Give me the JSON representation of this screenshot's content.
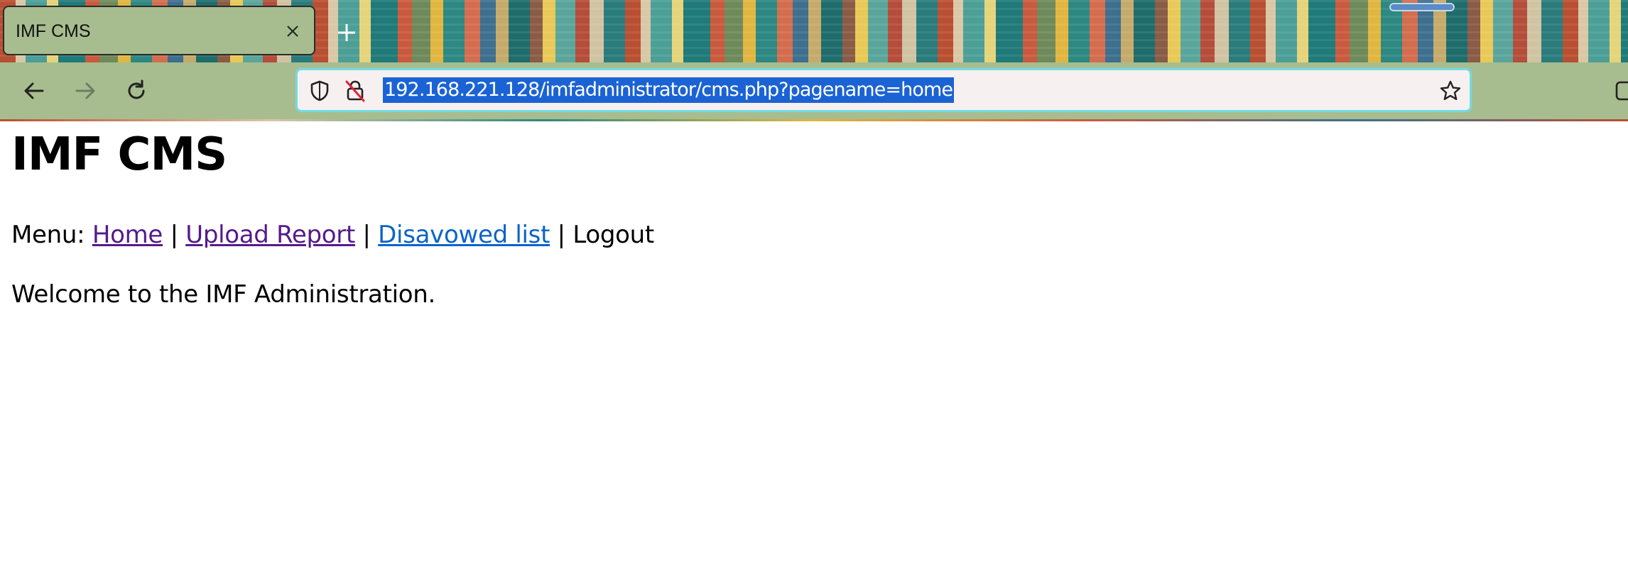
{
  "browser": {
    "tab": {
      "title": "IMF CMS",
      "close_icon": "close-icon"
    },
    "new_tab_icon": "plus-icon",
    "nav": {
      "back_icon": "arrow-left-icon",
      "forward_icon": "arrow-right-icon",
      "reload_icon": "reload-icon"
    },
    "urlbar": {
      "url": "192.168.221.128/imfadministrator/cms.php?pagename=home",
      "shield_icon": "shield-icon",
      "insecure_lock_icon": "insecure-lock-icon",
      "bookmark_icon": "star-icon",
      "selected_color": "#1b63d4",
      "focus_border_color": "#72dbe6"
    },
    "toolbar_color": "#a7bd8f"
  },
  "page": {
    "title": "IMF CMS",
    "menu": {
      "prefix": "Menu:",
      "separator": "|",
      "items": [
        {
          "label": "Home",
          "link": true,
          "visited": true
        },
        {
          "label": "Upload Report",
          "link": true,
          "visited": true
        },
        {
          "label": "Disavowed list",
          "link": true,
          "visited": false
        },
        {
          "label": "Logout",
          "link": false
        }
      ]
    },
    "welcome": "Welcome to the IMF Administration.",
    "link_colors": {
      "visited": "#551a8b",
      "unvisited": "#0b63c9"
    }
  }
}
